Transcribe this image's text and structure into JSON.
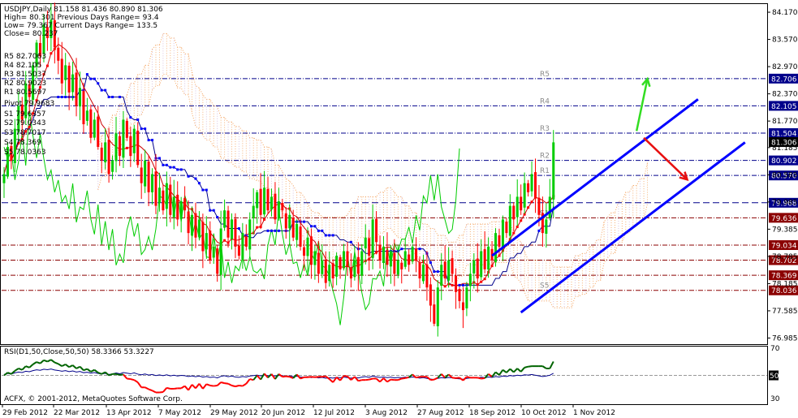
{
  "header": {
    "symbol_line": "USDJPY,Daily   81.158 81.436 80.890 81.306",
    "lines": [
      "High= 80.301    Previous Days Range= 93.4",
      "Low= 79.367    Current Days Range= 133.5",
      "Close= 80.237"
    ]
  },
  "pivot_labels": [
    "R5 82.7063",
    "R4 82.105",
    "R3 81.5037",
    "R2 80.9023",
    "R1 80.5697",
    "Pivot 79.9683",
    "S1 79.6357",
    "S2 79.0343",
    "S3 78.7017",
    "S4 78.369",
    "S5 78.0363"
  ],
  "footer": {
    "copyright": "ACFX, © 2001-2012, MetaQuotes Software Corp."
  },
  "rsi": {
    "label": "RSI(D1,50,Close,50,50) 58.3366 53.3227",
    "level_label": "50",
    "ticks": [
      "70",
      "30"
    ]
  },
  "colors": {
    "up": "#00cc00",
    "down": "#ff0000",
    "blue": "#0000ff",
    "navy": "#00008b",
    "green_line": "#00cc00",
    "cloud_a": "#f4a460",
    "cloud_b": "#d3b8d8",
    "pivot_line": "#00008b",
    "pivot_red": "#8b0000",
    "label_box": "#00008b"
  },
  "chart_data": {
    "type": "candlestick",
    "symbol": "USDJPY",
    "timeframe": "Daily",
    "ohlc_current": {
      "open": 81.158,
      "high": 81.436,
      "low": 80.89,
      "close": 81.306
    },
    "y_ticks": [
      "84.170",
      "83.570",
      "82.970",
      "82.370",
      "81.770",
      "81.185",
      "80.585",
      "79.985",
      "79.385",
      "78.785",
      "78.185",
      "77.585",
      "76.985"
    ],
    "x_ticks": [
      "29 Feb 2012",
      "22 Mar 2012",
      "13 Apr 2012",
      "7 May 2012",
      "29 May 2012",
      "20 Jun 2012",
      "12 Jul 2012",
      "3 Aug 2012",
      "27 Aug 2012",
      "18 Sep 2012",
      "10 Oct 2012",
      "1 Nov 2012"
    ],
    "ylim": [
      76.85,
      84.35
    ],
    "pivots": [
      {
        "name": "R5",
        "value": 82.706,
        "box": "82.706"
      },
      {
        "name": "R4",
        "value": 82.105,
        "box": "82.105"
      },
      {
        "name": "R3",
        "value": 81.504,
        "box": "81.504"
      },
      {
        "name": "",
        "value": 81.306,
        "box": "81.306",
        "current": true
      },
      {
        "name": "R2",
        "value": 80.902,
        "box": "80.902"
      },
      {
        "name": "R1",
        "value": 80.57,
        "box": "80.570"
      },
      {
        "name": "",
        "value": 79.968,
        "box": "79.968"
      },
      {
        "name": "S1",
        "value": 79.636,
        "box": "79.636"
      },
      {
        "name": "",
        "value": 79.034,
        "box": "79.034"
      },
      {
        "name": "",
        "value": 78.702,
        "box": "78.702"
      },
      {
        "name": "",
        "value": 78.369,
        "box": "78.369"
      },
      {
        "name": "S5",
        "value": 78.036,
        "box": "78.036"
      }
    ],
    "closes": [
      80.6,
      81.2,
      80.9,
      81.6,
      82.1,
      81.8,
      82.6,
      82.3,
      83.0,
      83.5,
      83.2,
      83.9,
      83.6,
      84.0,
      83.4,
      83.1,
      82.6,
      83.0,
      82.4,
      82.8,
      82.1,
      82.5,
      81.7,
      82.0,
      81.4,
      81.8,
      81.2,
      80.9,
      81.3,
      80.6,
      80.9,
      81.5,
      81.0,
      81.8,
      81.4,
      81.0,
      81.6,
      80.8,
      80.4,
      80.9,
      80.2,
      80.6,
      79.9,
      80.3,
      79.8,
      80.4,
      79.7,
      80.1,
      79.6,
      80.0,
      79.8,
      79.3,
      79.7,
      79.2,
      79.6,
      78.9,
      79.3,
      78.7,
      79.0,
      78.4,
      79.4,
      79.8,
      79.2,
      79.6,
      79.0,
      78.8,
      79.3,
      79.0,
      79.6,
      79.9,
      80.2,
      79.7,
      80.3,
      79.8,
      80.1,
      79.6,
      80.0,
      79.8,
      79.4,
      79.7,
      79.2,
      79.5,
      79.0,
      78.8,
      79.2,
      78.6,
      78.9,
      78.4,
      78.7,
      78.2,
      78.6,
      78.3,
      78.8,
      78.5,
      78.9,
      78.6,
      78.3,
      78.7,
      78.4,
      78.9,
      79.2,
      78.8,
      79.6,
      79.1,
      78.7,
      79.0,
      78.6,
      78.9,
      78.4,
      78.7,
      78.5,
      78.9,
      78.6,
      79.0,
      78.7,
      78.3,
      78.6,
      78.1,
      77.7,
      77.3,
      78.1,
      78.6,
      78.3,
      78.7,
      78.4,
      78.0,
      77.8,
      77.6,
      78.1,
      78.4,
      78.7,
      78.3,
      78.9,
      78.5,
      79.0,
      78.7,
      79.3,
      79.0,
      79.6,
      79.3,
      79.9,
      79.6,
      80.1,
      79.8,
      80.4,
      80.2,
      80.6,
      80.1,
      79.7,
      79.3,
      79.6,
      80.1,
      81.3
    ],
    "channel": [
      {
        "name": "upper",
        "start": {
          "index": 135,
          "value": 78.8
        },
        "end": {
          "index": 192,
          "value": 82.25
        }
      },
      {
        "name": "lower",
        "start": {
          "index": 143,
          "value": 77.55
        },
        "end": {
          "index": 205,
          "value": 81.3
        }
      }
    ],
    "arrows": [
      {
        "color": "green",
        "from": {
          "index": 175,
          "value": 81.55
        },
        "to": {
          "index": 178,
          "value": 82.7
        }
      },
      {
        "color": "red",
        "from": {
          "index": 177,
          "value": 81.4
        },
        "to": {
          "index": 189,
          "value": 80.48
        }
      }
    ],
    "rsi": {
      "level": 50,
      "ylim": [
        30,
        70
      ]
    }
  }
}
